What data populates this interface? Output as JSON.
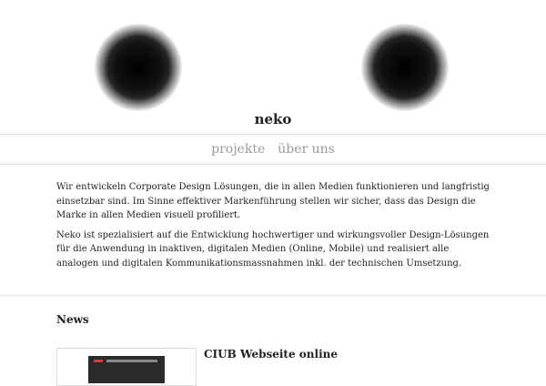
{
  "header": {
    "brand": "neko",
    "logo_shapes": [
      "blurred-circle",
      "blurred-circle"
    ]
  },
  "nav": {
    "items": [
      {
        "label": "projekte"
      },
      {
        "label": "über uns"
      }
    ]
  },
  "intro": {
    "paragraphs": [
      "Wir entwickeln Corporate Design Lösungen, die in allen Medien funktionieren und langfristig einsetzbar sind. Im Sinne effektiver Markenführung stellen wir sicher, dass das Design die Marke in allen Medien visuell profiliert.",
      "Neko ist spezialisiert auf die Entwicklung hochwertiger und wirkungsvoller Design-Lösungen für die Anwendung in inaktiven, digitalen Medien (Online, Mobile) und realisiert alle analogen und digitalen Kommunikationsmassnahmen inkl. der technischen Umsetzung."
    ]
  },
  "news": {
    "heading": "News",
    "items": [
      {
        "title": "CIUB Webseite online"
      }
    ]
  }
}
